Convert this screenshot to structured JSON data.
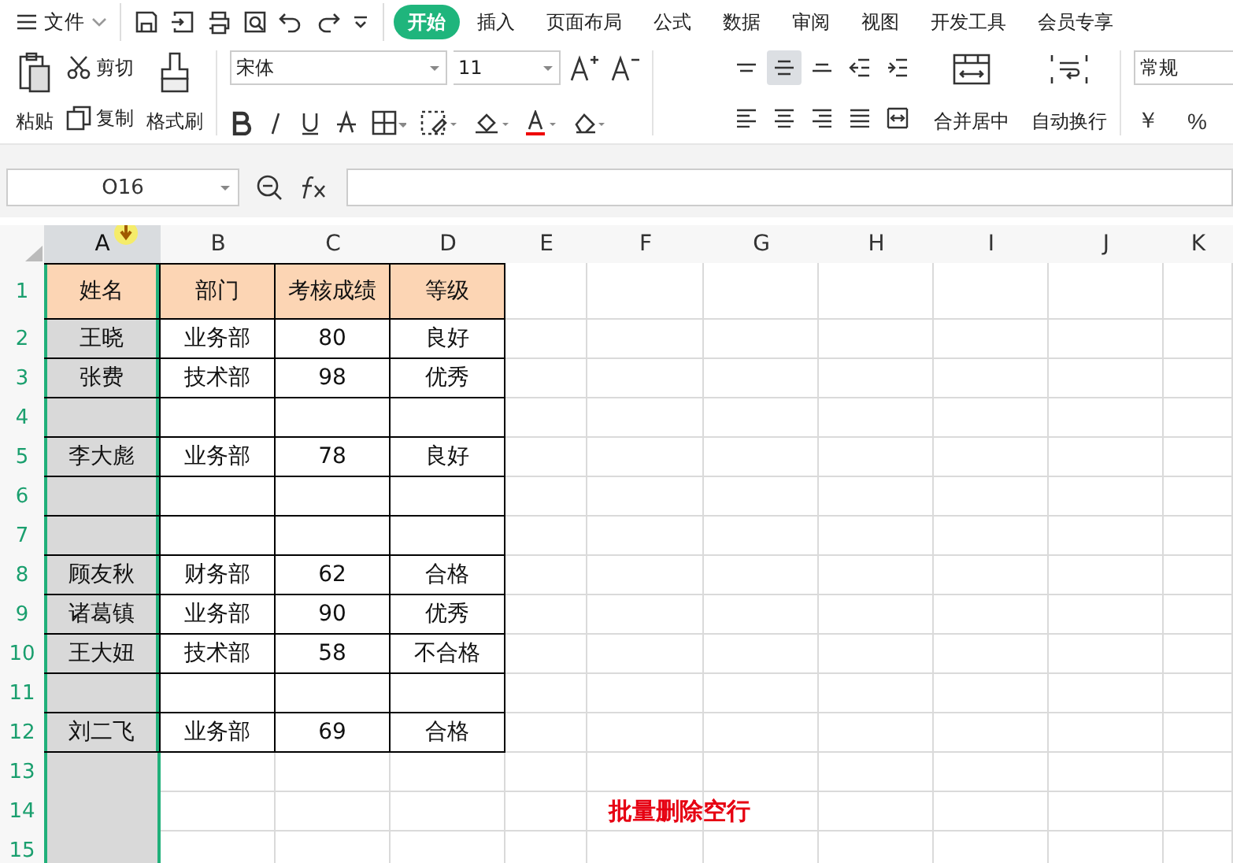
{
  "menubar": {
    "file_menu": "文件",
    "tabs": [
      {
        "label": "开始",
        "selected": true
      },
      {
        "label": "插入",
        "selected": false
      },
      {
        "label": "页面布局",
        "selected": false
      },
      {
        "label": "公式",
        "selected": false
      },
      {
        "label": "数据",
        "selected": false
      },
      {
        "label": "审阅",
        "selected": false
      },
      {
        "label": "视图",
        "selected": false
      },
      {
        "label": "开发工具",
        "selected": false
      },
      {
        "label": "会员专享",
        "selected": false
      }
    ]
  },
  "ribbon": {
    "paste": "粘贴",
    "cut": "剪切",
    "copy": "复制",
    "format_painter": "格式刷",
    "font": "宋体",
    "font_size": "11",
    "align_buttons": [
      {
        "kind": "top",
        "selected": false
      },
      {
        "kind": "middle",
        "selected": true
      },
      {
        "kind": "bottom",
        "selected": false
      },
      {
        "kind": "outdent",
        "selected": false
      },
      {
        "kind": "indent",
        "selected": false
      },
      {
        "kind": "left",
        "selected": false
      },
      {
        "kind": "center",
        "selected": false
      },
      {
        "kind": "right",
        "selected": false
      },
      {
        "kind": "justify",
        "selected": false
      },
      {
        "kind": "distributed",
        "selected": false
      }
    ],
    "merge": "合并居中",
    "wrap": "自动换行",
    "number_format": "常规",
    "currency": "￥",
    "percent": "%"
  },
  "formula_bar": {
    "name_box": "O16"
  },
  "sheet": {
    "columns": [
      {
        "label": "A",
        "selected": true
      },
      {
        "label": "B",
        "selected": false
      },
      {
        "label": "C",
        "selected": false
      },
      {
        "label": "D",
        "selected": false
      },
      {
        "label": "E",
        "selected": false
      },
      {
        "label": "F",
        "selected": false
      },
      {
        "label": "G",
        "selected": false
      },
      {
        "label": "H",
        "selected": false
      },
      {
        "label": "I",
        "selected": false
      },
      {
        "label": "J",
        "selected": false
      },
      {
        "label": "K",
        "selected": false
      }
    ],
    "table": {
      "header_row": "1",
      "columns": [
        "姓名",
        "部门",
        "考核成绩",
        "等级"
      ],
      "rows": [
        {
          "row": "2",
          "cells": [
            "王晓",
            "业务部",
            "80",
            "良好"
          ]
        },
        {
          "row": "3",
          "cells": [
            "张费",
            "技术部",
            "98",
            "优秀"
          ]
        },
        {
          "row": "4"
        },
        {
          "row": "5",
          "cells": [
            "李大彪",
            "业务部",
            "78",
            "良好"
          ]
        },
        {
          "row": "6"
        },
        {
          "row": "7"
        },
        {
          "row": "8",
          "cells": [
            "顾友秋",
            "财务部",
            "62",
            "合格"
          ]
        },
        {
          "row": "9",
          "cells": [
            "诸葛镇",
            "业务部",
            "90",
            "优秀"
          ]
        },
        {
          "row": "10",
          "cells": [
            "王大妞",
            "技术部",
            "58",
            "不合格"
          ]
        },
        {
          "row": "11"
        },
        {
          "row": "12",
          "cells": [
            "刘二飞",
            "业务部",
            "69",
            "合格"
          ]
        }
      ]
    },
    "extra_rows": [
      {
        "row": "13"
      },
      {
        "row": "14",
        "note": "批量删除空行"
      },
      {
        "row": "15"
      }
    ]
  }
}
